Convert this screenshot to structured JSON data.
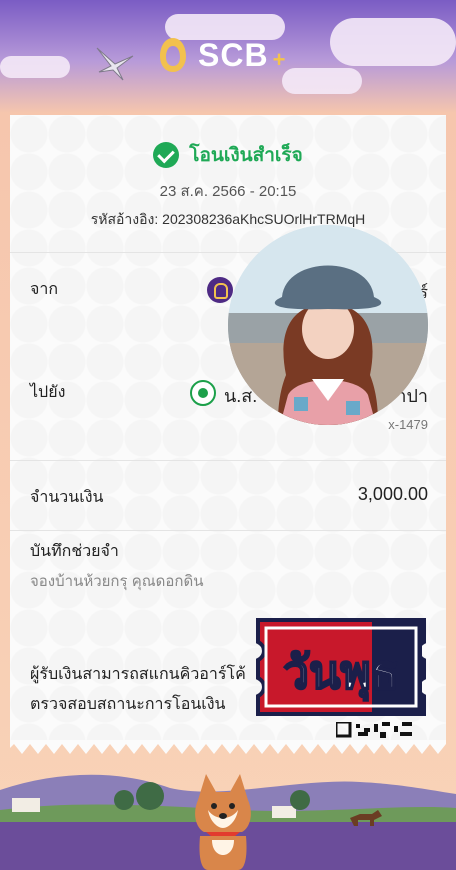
{
  "header": {
    "brand": "SCB",
    "brand_plus": "+"
  },
  "receipt": {
    "status": "โอนเงินสำเร็จ",
    "datetime": "23 ส.ค. 2566 - 20:15",
    "ref_label": "รหัสอ้างอิง:",
    "ref_value": "202308236aKhcSUOrlHrTRMqH",
    "from_label": "จาก",
    "from_name_visible": "ร์",
    "to_label": "ไปยัง",
    "to_name_start": "น.ส.",
    "to_name_end": "าปา",
    "to_account": "x-1479",
    "amount_label": "จำนวนเงิน",
    "amount_value": "3,000.00",
    "memo_label": "บันทึกช่วยจำ",
    "memo_value": "จองบ้านห้วยกรุ คุณดอกดิน",
    "qr_note_line1": "ผู้รับเงินสามารถสแกนคิวอาร์โค้",
    "qr_note_line2": "ตรวจสอบสถานะการโอนเงิน"
  },
  "sticker": {
    "text": "วันพุธ"
  },
  "colors": {
    "success": "#1fa956",
    "brand_purple": "#4e2a84",
    "brand_gold": "#f2c14e",
    "sticker_red": "#c8182b",
    "sticker_navy": "#1b1f4a"
  },
  "icons": [
    "scb-logo-icon",
    "check-circle-icon",
    "scb-bank-icon",
    "kbank-icon",
    "bird-icon",
    "qr-code-icon"
  ]
}
